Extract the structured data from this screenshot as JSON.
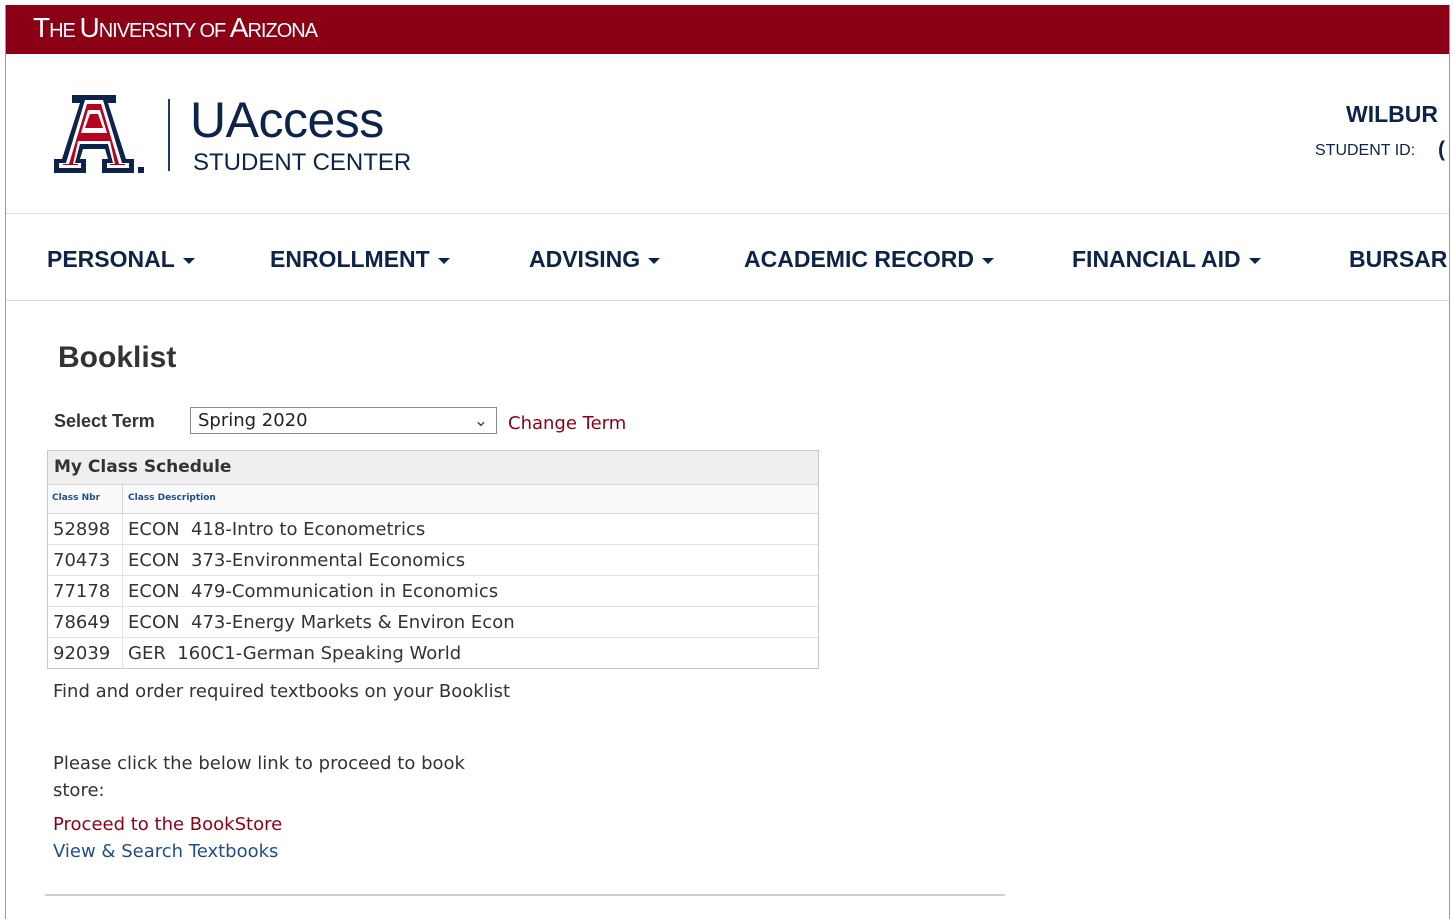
{
  "header": {
    "university_prefix": "T",
    "university_rest": "HE ",
    "university_u": "U",
    "university_niversity": "NIVERSITY OF ",
    "university_a": "A",
    "university_rizona": "RIZONA"
  },
  "brand": {
    "title": "UAccess",
    "subtitle": "STUDENT CENTER"
  },
  "user": {
    "name": "WILBUR",
    "student_id_label": "STUDENT ID:",
    "student_id_value": "("
  },
  "nav": {
    "items": [
      {
        "label": "PERSONAL"
      },
      {
        "label": "ENROLLMENT"
      },
      {
        "label": "ADVISING"
      },
      {
        "label": "ACADEMIC RECORD"
      },
      {
        "label": "FINANCIAL AID"
      },
      {
        "label": "BURSAR"
      }
    ]
  },
  "page": {
    "title": "Booklist"
  },
  "term": {
    "label": "Select Term",
    "selected": "Spring 2020",
    "change_link": "Change Term"
  },
  "schedule": {
    "heading": "My Class Schedule",
    "columns": [
      "Class Nbr",
      "Class Description"
    ],
    "rows": [
      {
        "nbr": "52898",
        "desc": "ECON  418-Intro to Econometrics"
      },
      {
        "nbr": "70473",
        "desc": "ECON  373-Environmental Economics"
      },
      {
        "nbr": "77178",
        "desc": "ECON  479-Communication in Economics"
      },
      {
        "nbr": "78649",
        "desc": "ECON  473-Energy Markets & Environ Econ"
      },
      {
        "nbr": "92039",
        "desc": "GER  160C1-German Speaking World"
      }
    ]
  },
  "info": {
    "line1": "Find and order required textbooks on your Booklist",
    "line2": "Please click the below link to proceed to book store:",
    "bookstore_link": "Proceed to the BookStore",
    "textbooks_link": "View & Search Textbooks"
  },
  "colors": {
    "brand_red": "#8b0015",
    "brand_navy": "#0c234b",
    "link_blue": "#1d4e8a"
  }
}
